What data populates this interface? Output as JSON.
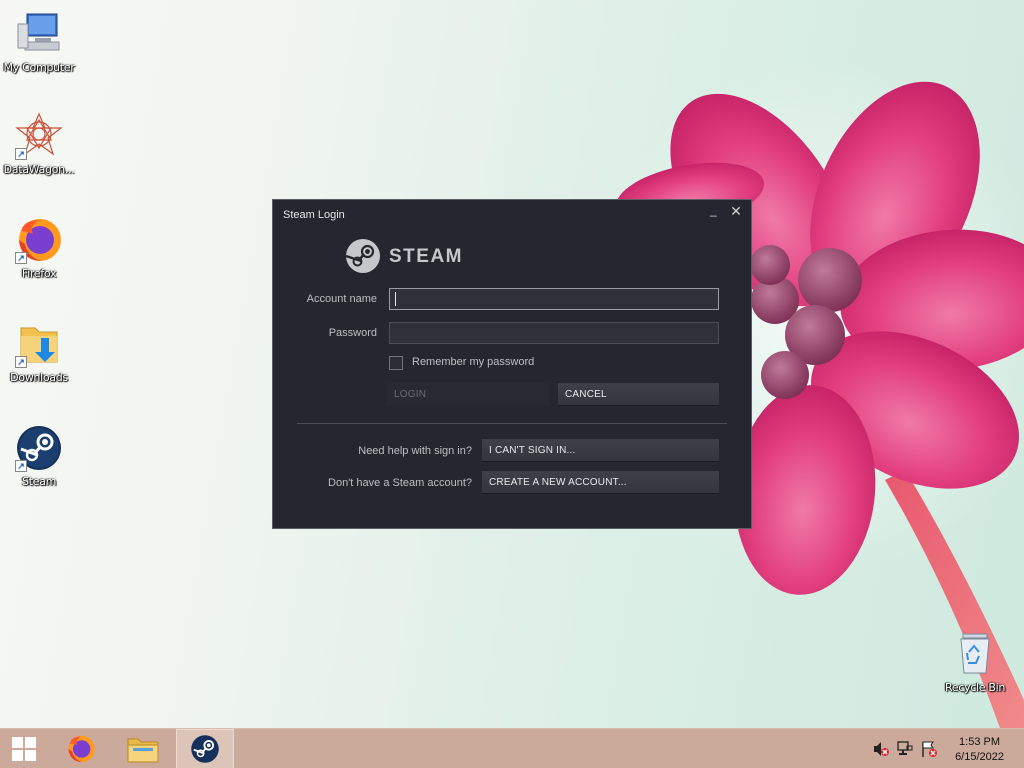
{
  "desktop": {
    "icons": [
      {
        "label": "My Computer"
      },
      {
        "label": "DataWagon..."
      },
      {
        "label": "Firefox"
      },
      {
        "label": "Downloads"
      },
      {
        "label": "Steam"
      },
      {
        "label": "Recycle Bin"
      }
    ]
  },
  "dialog": {
    "title": "Steam Login",
    "minimize_glyph": "_",
    "close_glyph": "✕",
    "logo_text": "STEAM",
    "account_label": "Account name",
    "account_value": "",
    "password_label": "Password",
    "password_value": "",
    "remember_label": "Remember my password",
    "remember_checked": false,
    "login_label": "LOGIN",
    "cancel_label": "CANCEL",
    "help_prompt": "Need help with sign in?",
    "cant_sign_in_label": "I CAN'T SIGN IN...",
    "no_account_prompt": "Don't have a Steam account?",
    "create_account_label": "CREATE A NEW ACCOUNT..."
  },
  "taskbar": {
    "items": [
      {
        "name": "start",
        "icon": "windows-logo-icon"
      },
      {
        "name": "firefox",
        "icon": "firefox-icon"
      },
      {
        "name": "file-explorer",
        "icon": "folder-icon"
      },
      {
        "name": "steam",
        "icon": "steam-icon",
        "active": true
      }
    ],
    "tray": [
      "volume-muted-icon",
      "network-icon",
      "action-center-flag-icon"
    ],
    "time": "1:53 PM",
    "date": "6/15/2022"
  },
  "colors": {
    "dialog_bg": "#24272d",
    "taskbar_bg": "#cba99b",
    "flower_pink": "#e0357a"
  }
}
